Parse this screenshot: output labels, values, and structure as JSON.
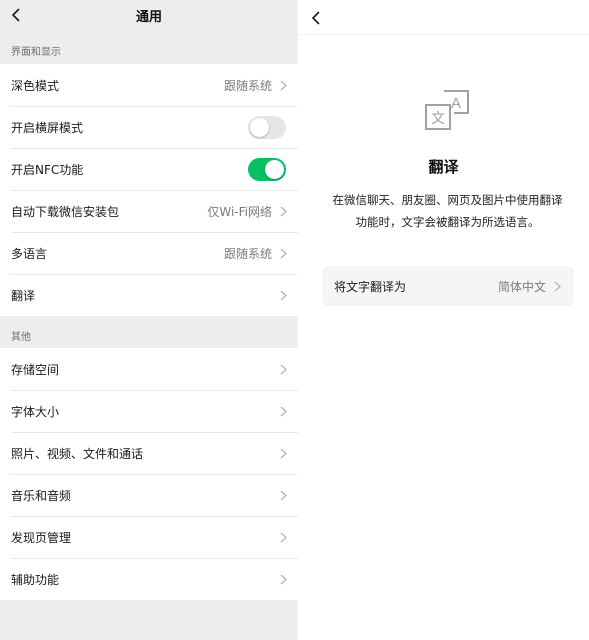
{
  "left": {
    "title": "通用",
    "sections": [
      {
        "header": "界面和显示",
        "rows": [
          {
            "label": "深色模式",
            "value": "跟随系统",
            "type": "link"
          },
          {
            "label": "开启横屏模式",
            "value": "",
            "type": "toggle",
            "on": false
          },
          {
            "label": "开启NFC功能",
            "value": "",
            "type": "toggle",
            "on": true
          },
          {
            "label": "自动下载微信安装包",
            "value": "仅Wi-Fi网络",
            "type": "link"
          },
          {
            "label": "多语言",
            "value": "跟随系统",
            "type": "link"
          },
          {
            "label": "翻译",
            "value": "",
            "type": "link"
          }
        ]
      },
      {
        "header": "其他",
        "rows": [
          {
            "label": "存储空间",
            "value": "",
            "type": "link"
          },
          {
            "label": "字体大小",
            "value": "",
            "type": "link"
          },
          {
            "label": "照片、视频、文件和通话",
            "value": "",
            "type": "link"
          },
          {
            "label": "音乐和音频",
            "value": "",
            "type": "link"
          },
          {
            "label": "发现页管理",
            "value": "",
            "type": "link"
          },
          {
            "label": "辅助功能",
            "value": "",
            "type": "link"
          }
        ]
      }
    ]
  },
  "right": {
    "icon": "translate-icon",
    "title": "翻译",
    "description_line1": "在微信聊天、朋友圈、网页及图片中使用翻译",
    "description_line2": "功能时，文字会被翻译为所选语言。",
    "setting_label": "将文字翻译为",
    "setting_value": "简体中文"
  },
  "colors": {
    "accent": "#07c160",
    "background": "#ededed",
    "card": "#f5f5f5"
  }
}
